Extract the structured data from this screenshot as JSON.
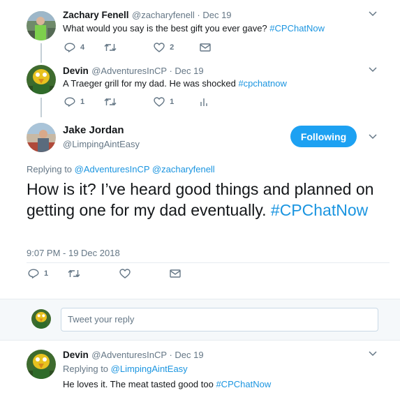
{
  "tweets": [
    {
      "name": "Zachary Fenell",
      "handle": "@zacharyfenell · Dec 19",
      "text": "What would you say is the best gift you ever gave? ",
      "hashtag": "#CPChatNow",
      "replies": "4",
      "likes": "2"
    },
    {
      "name": "Devin",
      "handle": "@AdventuresInCP · Dec 19",
      "text": "A Traeger grill for my dad. He was shocked ",
      "hashtag": "#cpchatnow",
      "replies": "1",
      "likes": "1"
    }
  ],
  "main_tweet": {
    "name": "Jake Jordan",
    "handle": "@LimpingAintEasy",
    "follow_label": "Following",
    "replying_prefix": "Replying to ",
    "replying_to_1": "@AdventuresInCP",
    "replying_to_2": "@zacharyfenell",
    "text": "How is it? I’ve heard good things and planned on getting one for my dad eventually. ",
    "hashtag": "#CPChatNow",
    "timestamp": "9:07 PM - 19 Dec 2018",
    "replies": "1"
  },
  "reply_box": {
    "placeholder": "Tweet your reply"
  },
  "reply_tweet": {
    "name": "Devin",
    "handle": "@AdventuresInCP · Dec 19",
    "replying_prefix": "Replying to ",
    "replying_to": "@LimpingAintEasy",
    "text": "He loves it. The meat tasted good too ",
    "hashtag": "#CPChatNow"
  },
  "colors": {
    "accent": "#1da1f2",
    "link": "#1b95e0",
    "muted": "#657786"
  },
  "icons": [
    "reply-icon",
    "retweet-icon",
    "like-icon",
    "message-icon",
    "analytics-icon",
    "chevron-down-icon"
  ]
}
